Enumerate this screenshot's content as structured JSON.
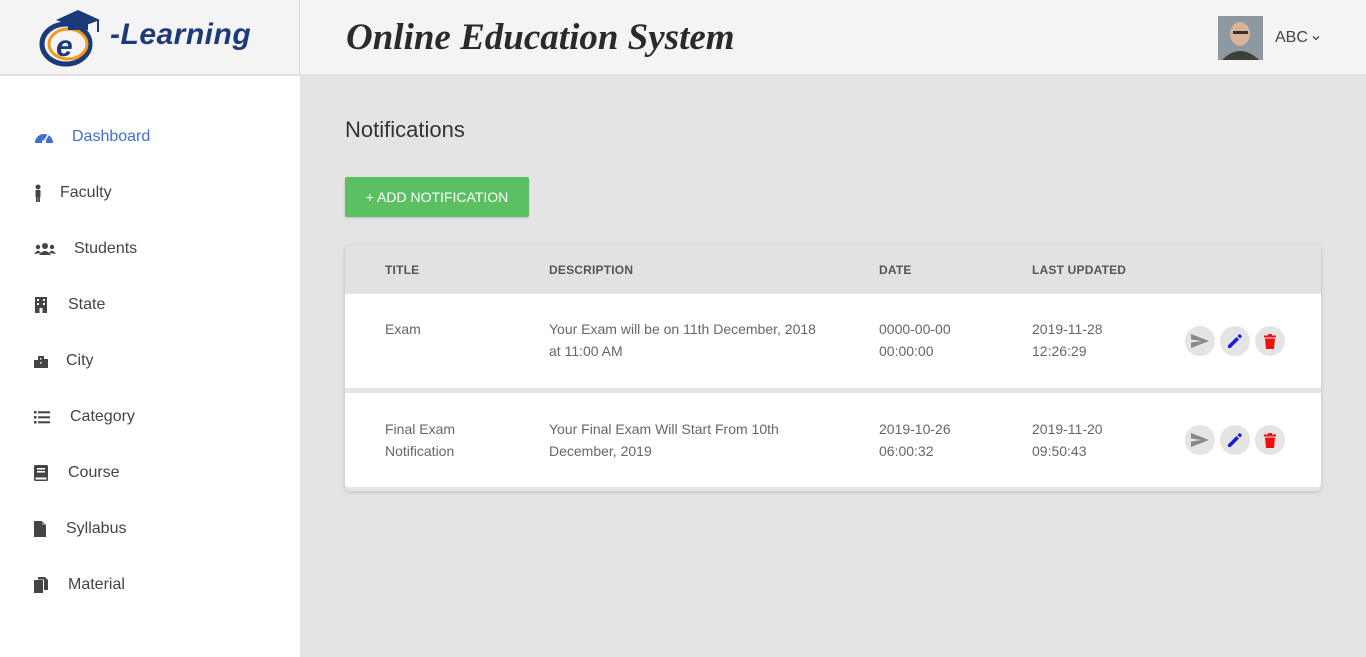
{
  "brand": {
    "logo_text": "-Learning",
    "logo_letter": "e"
  },
  "header": {
    "title": "Online Education System",
    "user_name": "ABC"
  },
  "sidebar": {
    "items": [
      {
        "label": "Dashboard",
        "icon": "dashboard-icon",
        "active": true
      },
      {
        "label": "Faculty",
        "icon": "person-icon"
      },
      {
        "label": "Students",
        "icon": "users-icon"
      },
      {
        "label": "State",
        "icon": "building-icon"
      },
      {
        "label": "City",
        "icon": "city-icon"
      },
      {
        "label": "Category",
        "icon": "list-icon"
      },
      {
        "label": "Course",
        "icon": "book-icon"
      },
      {
        "label": "Syllabus",
        "icon": "file-icon"
      },
      {
        "label": "Material",
        "icon": "copy-icon"
      }
    ]
  },
  "main": {
    "heading": "Notifications",
    "add_button": "+ ADD NOTIFICATION",
    "table": {
      "columns": [
        "TITLE",
        "DESCRIPTION",
        "DATE",
        "LAST UPDATED"
      ],
      "rows": [
        {
          "title": [
            "Exam",
            ""
          ],
          "description": [
            "Your Exam will be on 11th December, 2018",
            "at 11:00 AM"
          ],
          "date": [
            "0000-00-00",
            "00:00:00"
          ],
          "updated": [
            "2019-11-28",
            "12:26:29"
          ]
        },
        {
          "title": [
            "Final Exam",
            "Notification"
          ],
          "description": [
            "Your Final Exam Will Start From 10th",
            "December, 2019"
          ],
          "date": [
            "2019-10-26",
            "06:00:32"
          ],
          "updated": [
            "2019-11-20",
            "09:50:43"
          ]
        }
      ]
    }
  },
  "colors": {
    "accent": "#3f6fd1",
    "add_button": "#5cbf62",
    "edit_icon": "#1a1adb",
    "delete_icon": "#ee1111",
    "send_icon": "#888888"
  },
  "icons": {
    "send": "send-icon",
    "edit": "pencil-icon",
    "delete": "trash-icon"
  }
}
